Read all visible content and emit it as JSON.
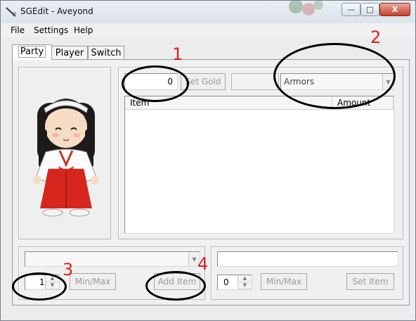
{
  "window": {
    "title": "SGEdit - Aveyond",
    "minimize": "—",
    "maximize": "□",
    "close": "X"
  },
  "menu": {
    "file": "File",
    "settings": "Settings",
    "help": "Help"
  },
  "tabs": [
    {
      "label": "Party"
    },
    {
      "label": "Player"
    },
    {
      "label": "Switch"
    }
  ],
  "gold": {
    "value": "0",
    "set_gold_label": "Set Gold"
  },
  "category": {
    "selected": "Armors"
  },
  "items_table": {
    "columns": [
      "Item",
      "Amount"
    ]
  },
  "left_controls": {
    "quantity": "1",
    "minmax_label": "Min/Max",
    "add_item_label": "Add Item"
  },
  "right_controls": {
    "quantity": "0",
    "minmax_label": "Min/Max",
    "set_item_label": "Set Item"
  },
  "annotations": {
    "n1": "1",
    "n2": "2",
    "n3": "3",
    "n4": "4",
    "color": "#e01c1c"
  }
}
